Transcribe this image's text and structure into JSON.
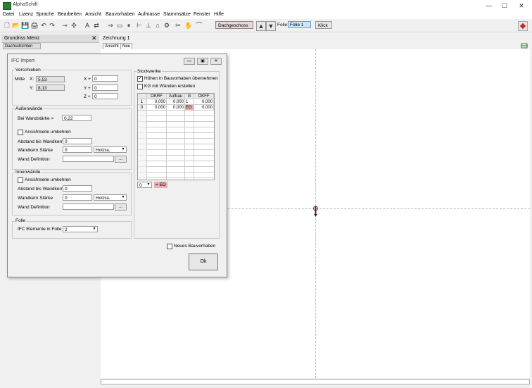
{
  "app": {
    "title": "AlphaSchift"
  },
  "window_controls": {
    "minimize": "—",
    "maximize": "☐",
    "close": "✕"
  },
  "menu": [
    "Datei",
    "Lizenz",
    "Sprache",
    "Bearbeiten",
    "Ansicht",
    "Bauvorhaben",
    "Aufmasse",
    "Stammsätze",
    "Fenster",
    "Hilfe"
  ],
  "toolbar": {
    "icons": [
      "new-file-icon",
      "open-folder-icon",
      "save-icon",
      "print-icon",
      "undo-icon",
      "redo-icon",
      "line-tool-icon",
      "move-tool-icon",
      "text-tool-icon",
      "dimension-icon",
      "arrows-icon",
      "window-icon",
      "pause-icon",
      "door-icon",
      "stair-icon",
      "roof-icon",
      "settings-icon",
      "tools-icon",
      "hand-icon",
      "curve-icon"
    ],
    "icon_glyphs": [
      "🗋",
      "📂",
      "💾",
      "🖨",
      "↶",
      "↷",
      "⊸",
      "✣",
      "A",
      "⇄",
      "⇒",
      "▭",
      "⏸",
      "⊢",
      "⊥",
      "⌂",
      "⚙",
      "✂",
      "✋",
      "⌒"
    ],
    "floor": "Dachgeschoss",
    "folie_label": "Folie:",
    "folie_value": "Folie 1",
    "klick_label": "Klick"
  },
  "left_panel": {
    "title": "Grundriss Menü",
    "close": "✕",
    "tab": "Dachschichten"
  },
  "drawing": {
    "title": "Zeichnung 1",
    "tabs": [
      "Ansicht",
      "Neu"
    ]
  },
  "dialog": {
    "title": "IFC Import",
    "window_buttons": [
      "▭",
      "▣",
      "✕"
    ],
    "verschieben": {
      "label": "Verschieben",
      "mitte_label": "Mitte",
      "x_label": "X:",
      "x_value": "5,53",
      "y_label": "Y:",
      "y_value": "8,13",
      "xplus_label": "X +",
      "xplus_value": "0",
      "yplus_label": "Y +",
      "yplus_value": "0",
      "zplus_label": "Z +",
      "zplus_value": "0"
    },
    "aussen": {
      "label": "Außenwände",
      "bei_label": "Bei Wandstärke >",
      "bei_value": "0,22",
      "ansicht_label": "Ansichtseite umkehren",
      "abstand_label": "Abstand bis Wandkern",
      "abstand_value": "0",
      "wandkern_label": "Wandkern Stärke",
      "wandkern_value": "0",
      "material": "Holzra.",
      "def_label": "Wand Definition",
      "def_value": "",
      "dots": "..."
    },
    "innen": {
      "label": "Innenwände",
      "ansicht_label": "Ansichtseite umkehren",
      "abstand_label": "Abstand bis Wandkern",
      "abstand_value": "0",
      "wandkern_label": "Wandkern Stärke",
      "wandkern_value": "0",
      "material": "Holzra.",
      "def_label": "Wand Definition",
      "def_value": "",
      "dots": "..."
    },
    "folie": {
      "label": "Folie",
      "ifc_label": "IFC Elemente in Folie",
      "ifc_value": "2"
    },
    "stockwerke": {
      "label": "Stockwerke",
      "hoehen_label": "Höhen in Bauvorhaben übernehmen",
      "hoehen_checked": "✓",
      "kg_label": "KG mit Wänden erstellen",
      "columns": [
        "",
        "OKRF",
        "Aufbau",
        "G",
        "OKFF"
      ],
      "rows": [
        [
          "1",
          "0,000",
          "0,000",
          "1",
          "0,000"
        ],
        [
          "0",
          "0,000",
          "0,000",
          "EG",
          "0,000"
        ]
      ],
      "select_value": "0",
      "select_suffix": "= EG"
    },
    "neues_label": "Neues Bauvorhaben",
    "ok_label": "Ok"
  },
  "colors": {
    "accent_selection": "#cfe3f7",
    "floor_box": "#e8d8d8",
    "eg_cell": "#e8b0b0",
    "origin": "#c62828"
  }
}
